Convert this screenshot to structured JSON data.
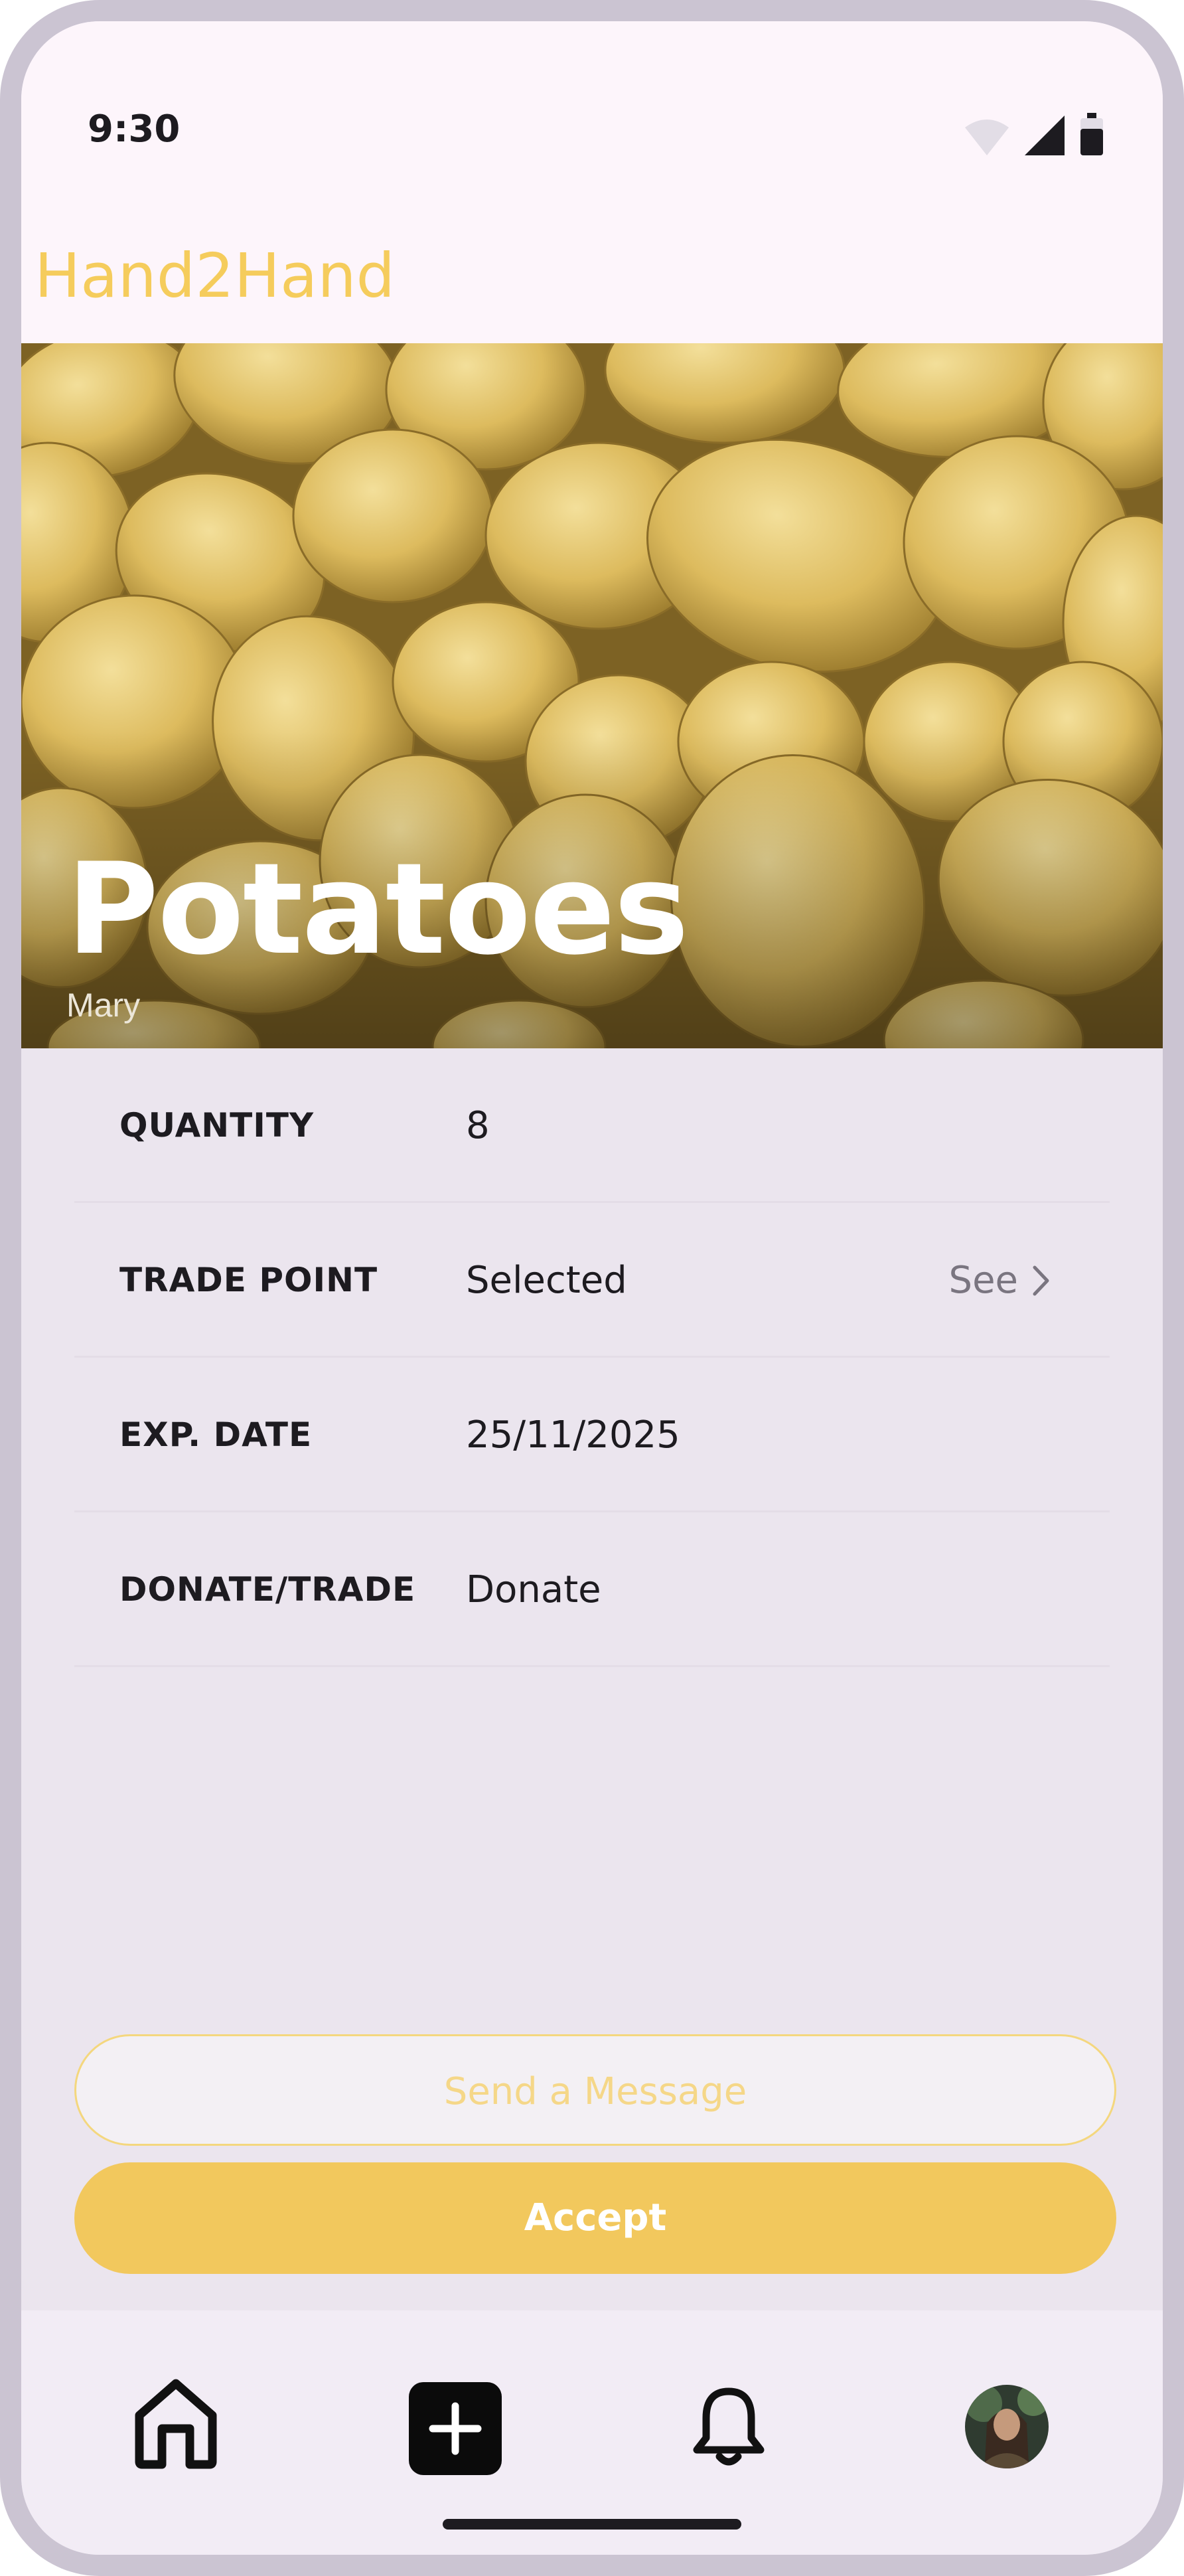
{
  "status_bar": {
    "time": "9:30"
  },
  "app": {
    "title": "Hand2Hand"
  },
  "item": {
    "name": "Potatoes",
    "owner": "Mary"
  },
  "details": [
    {
      "label": "QUANTITY",
      "value": "8"
    },
    {
      "label": "TRADE POINT",
      "value": "Selected",
      "action": "See"
    },
    {
      "label": "EXP. DATE",
      "value": "25/11/2025"
    },
    {
      "label": "DONATE/TRADE",
      "value": "Donate"
    }
  ],
  "actions": {
    "message_label": "Send a Message",
    "accept_label": "Accept"
  },
  "bottom_nav": {
    "items": [
      {
        "icon": "home-icon"
      },
      {
        "icon": "add-icon"
      },
      {
        "icon": "bell-icon"
      },
      {
        "icon": "profile-avatar"
      }
    ]
  },
  "colors": {
    "accent": "#f2c85d",
    "title": "#f5cc5c",
    "background": "#ebe5ee"
  }
}
